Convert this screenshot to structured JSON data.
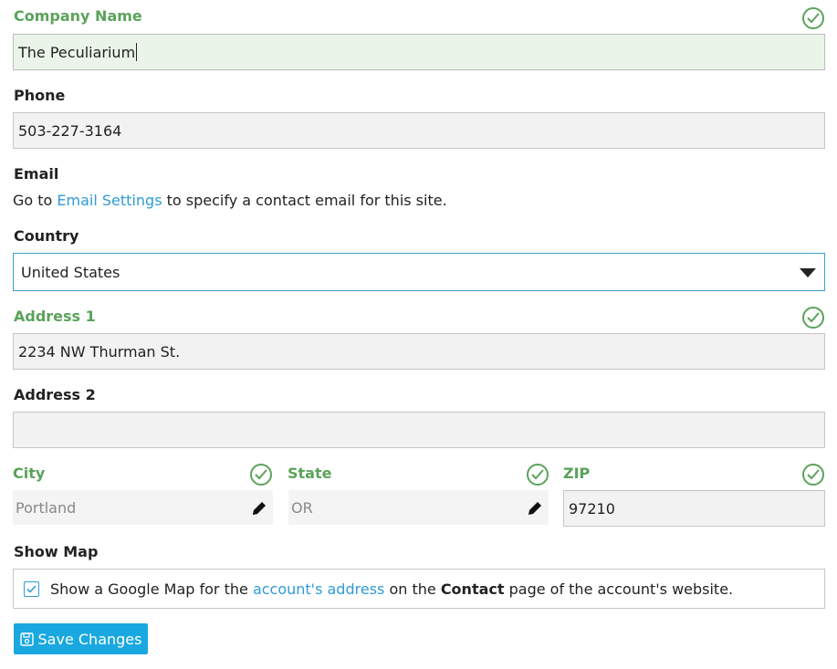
{
  "company": {
    "label": "Company Name",
    "value": "The Peculiarium"
  },
  "phone": {
    "label": "Phone",
    "value": "503-227-3164"
  },
  "email": {
    "label": "Email",
    "text_before": "Go to ",
    "link": "Email Settings",
    "text_after": " to specify a contact email for this site."
  },
  "country": {
    "label": "Country",
    "value": "United States"
  },
  "address1": {
    "label": "Address 1",
    "value": "2234 NW Thurman St."
  },
  "address2": {
    "label": "Address 2",
    "value": ""
  },
  "city": {
    "label": "City",
    "value": "Portland"
  },
  "state": {
    "label": "State",
    "value": "OR"
  },
  "zip": {
    "label": "ZIP",
    "value": "97210"
  },
  "map": {
    "label": "Show Map",
    "text1": "Show a Google Map for the ",
    "link": "account's address",
    "text2": " on the ",
    "bold": "Contact",
    "text3": " page of the account's website.",
    "checked": true
  },
  "save_label": "Save Changes",
  "colors": {
    "valid": "#5aa35a",
    "accent": "#1aa8e0",
    "link": "#2f9bd6"
  }
}
